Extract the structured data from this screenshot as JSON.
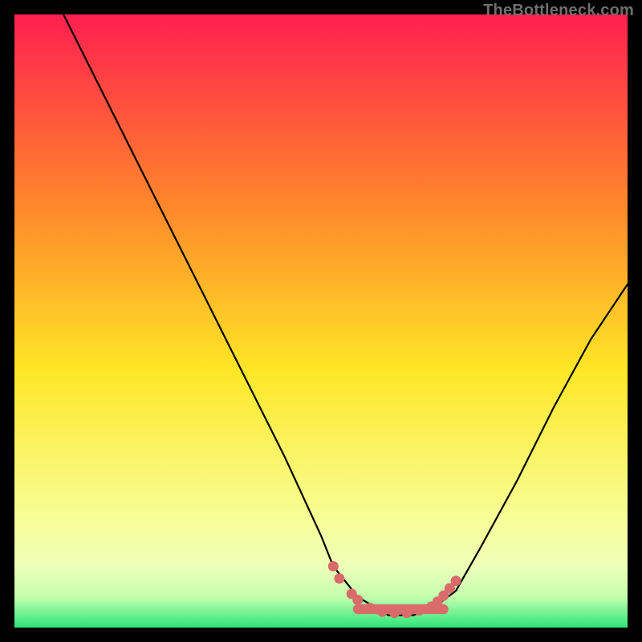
{
  "watermark": "TheBottleneck.com",
  "colors": {
    "bg": "#000000",
    "grad_top": "#ff1f4f",
    "grad_mid1": "#ff8a2a",
    "grad_mid2": "#ffe726",
    "grad_low": "#f6ff9a",
    "grad_green": "#2de57a",
    "curve": "#000000",
    "marker": "#d96b6a"
  },
  "chart_data": {
    "type": "line",
    "title": "",
    "xlabel": "",
    "ylabel": "",
    "xlim": [
      0,
      100
    ],
    "ylim": [
      0,
      100
    ],
    "series": [
      {
        "name": "bottleneck-curve",
        "x": [
          8,
          14,
          20,
          26,
          32,
          38,
          44,
          50,
          52,
          56,
          61,
          65,
          68,
          72,
          76,
          82,
          88,
          94,
          100
        ],
        "y": [
          100,
          88,
          76,
          64,
          52,
          40,
          28,
          15,
          10,
          5,
          2,
          2,
          3,
          6,
          13,
          24,
          36,
          47,
          56
        ]
      }
    ],
    "flat_region": {
      "x_start": 56,
      "x_end": 70,
      "y": 3
    },
    "markers": [
      {
        "x": 52,
        "y": 10
      },
      {
        "x": 53,
        "y": 8
      },
      {
        "x": 55,
        "y": 5.5
      },
      {
        "x": 56,
        "y": 4.5
      },
      {
        "x": 58,
        "y": 3.2
      },
      {
        "x": 60,
        "y": 2.6
      },
      {
        "x": 62,
        "y": 2.4
      },
      {
        "x": 64,
        "y": 2.4
      },
      {
        "x": 66,
        "y": 2.8
      },
      {
        "x": 68,
        "y": 3.4
      },
      {
        "x": 69,
        "y": 4.2
      },
      {
        "x": 70,
        "y": 5.2
      },
      {
        "x": 71,
        "y": 6.4
      },
      {
        "x": 72,
        "y": 7.6
      }
    ]
  }
}
